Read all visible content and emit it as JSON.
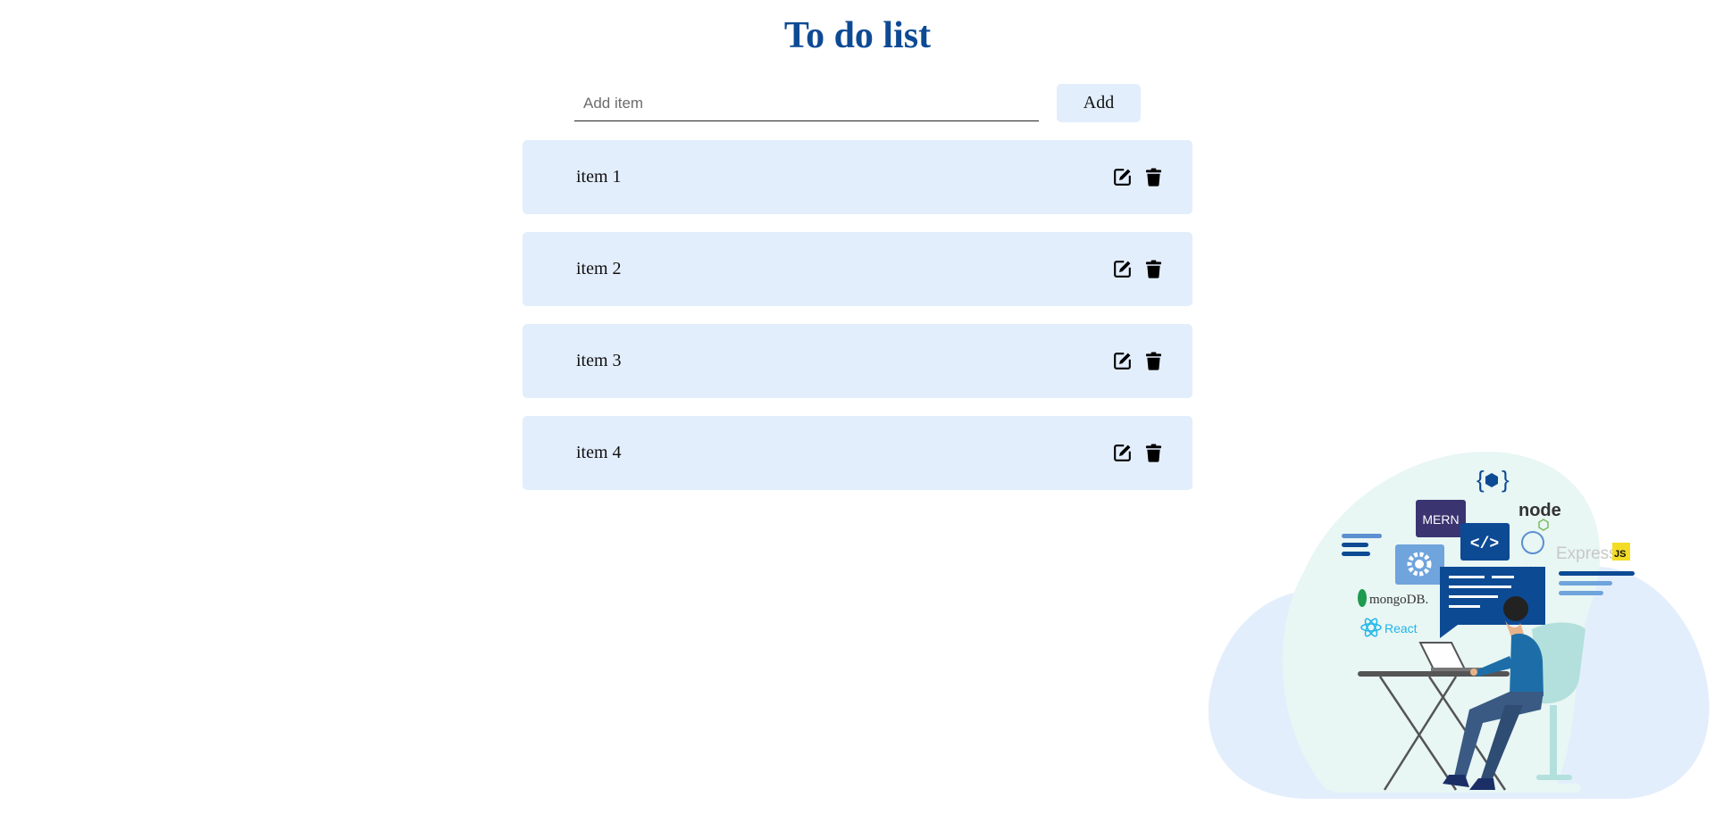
{
  "header": {
    "title": "To do list"
  },
  "add_form": {
    "placeholder": "Add item",
    "value": "",
    "button_label": "Add"
  },
  "todos": [
    {
      "label": "item 1"
    },
    {
      "label": "item 2"
    },
    {
      "label": "item 3"
    },
    {
      "label": "item 4"
    }
  ],
  "icons": {
    "edit": "edit-icon",
    "delete": "trash-icon"
  },
  "illustration": {
    "badges": {
      "mern": "MERN",
      "node": "node",
      "express": "Express",
      "js": "JS",
      "mongodb": "mongoDB.",
      "react": "React"
    }
  },
  "colors": {
    "title": "#0d4a94",
    "item_bg": "#e3eefc",
    "accent_dark": "#0d4a94"
  }
}
